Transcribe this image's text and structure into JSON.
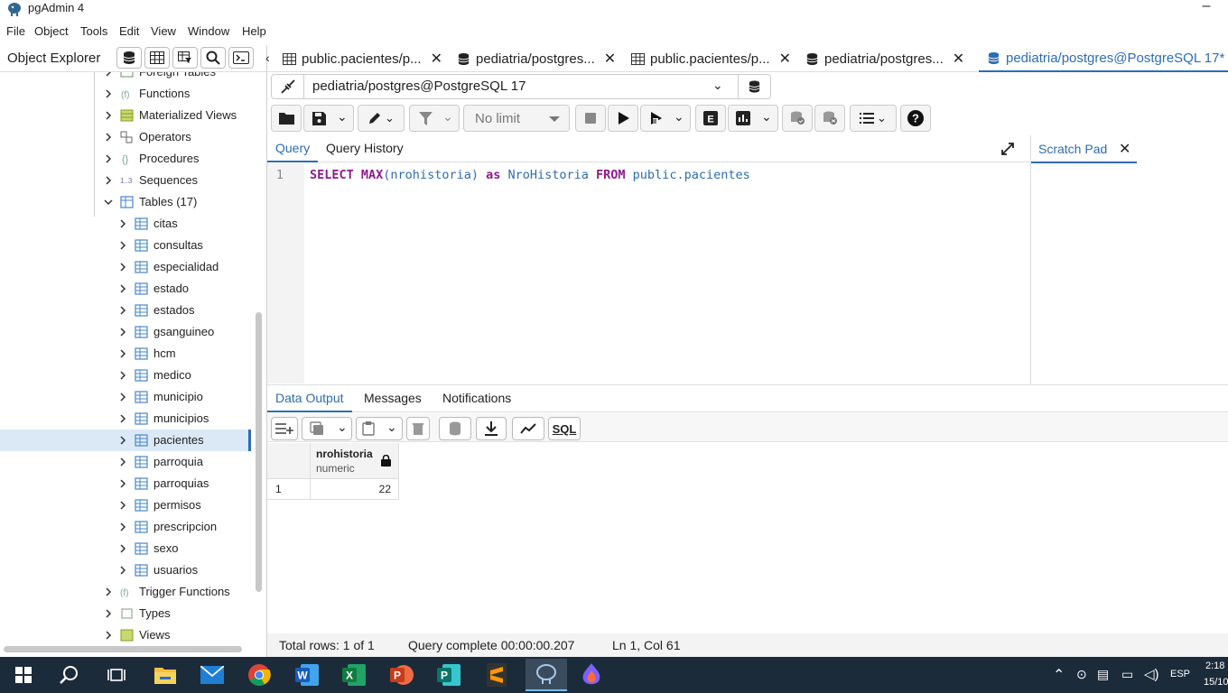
{
  "app": {
    "title": "pgAdmin 4"
  },
  "menu": [
    "File",
    "Object",
    "Tools",
    "Edit",
    "View",
    "Window",
    "Help"
  ],
  "explorer": {
    "title": "Object Explorer",
    "tree": [
      {
        "label": "Foreign Tables",
        "level": 1,
        "expanded": false,
        "icon": "foreign-table-icon"
      },
      {
        "label": "Functions",
        "level": 1,
        "expanded": false,
        "icon": "function-icon"
      },
      {
        "label": "Materialized Views",
        "level": 1,
        "expanded": false,
        "icon": "mview-icon"
      },
      {
        "label": "Operators",
        "level": 1,
        "expanded": false,
        "icon": "operator-icon"
      },
      {
        "label": "Procedures",
        "level": 1,
        "expanded": false,
        "icon": "procedure-icon"
      },
      {
        "label": "Sequences",
        "level": 1,
        "expanded": false,
        "icon": "sequence-icon"
      },
      {
        "label": "Tables (17)",
        "level": 1,
        "expanded": true,
        "icon": "tables-icon"
      },
      {
        "label": "citas",
        "level": 2,
        "expanded": false,
        "icon": "table-icon"
      },
      {
        "label": "consultas",
        "level": 2,
        "expanded": false,
        "icon": "table-icon"
      },
      {
        "label": "especialidad",
        "level": 2,
        "expanded": false,
        "icon": "table-icon"
      },
      {
        "label": "estado",
        "level": 2,
        "expanded": false,
        "icon": "table-icon"
      },
      {
        "label": "estados",
        "level": 2,
        "expanded": false,
        "icon": "table-icon"
      },
      {
        "label": "gsanguineo",
        "level": 2,
        "expanded": false,
        "icon": "table-icon"
      },
      {
        "label": "hcm",
        "level": 2,
        "expanded": false,
        "icon": "table-icon"
      },
      {
        "label": "medico",
        "level": 2,
        "expanded": false,
        "icon": "table-icon"
      },
      {
        "label": "municipio",
        "level": 2,
        "expanded": false,
        "icon": "table-icon"
      },
      {
        "label": "municipios",
        "level": 2,
        "expanded": false,
        "icon": "table-icon"
      },
      {
        "label": "pacientes",
        "level": 2,
        "expanded": false,
        "icon": "table-icon",
        "selected": true
      },
      {
        "label": "parroquia",
        "level": 2,
        "expanded": false,
        "icon": "table-icon"
      },
      {
        "label": "parroquias",
        "level": 2,
        "expanded": false,
        "icon": "table-icon"
      },
      {
        "label": "permisos",
        "level": 2,
        "expanded": false,
        "icon": "table-icon"
      },
      {
        "label": "prescripcion",
        "level": 2,
        "expanded": false,
        "icon": "table-icon"
      },
      {
        "label": "sexo",
        "level": 2,
        "expanded": false,
        "icon": "table-icon"
      },
      {
        "label": "usuarios",
        "level": 2,
        "expanded": false,
        "icon": "table-icon"
      },
      {
        "label": "Trigger Functions",
        "level": 1,
        "expanded": false,
        "icon": "trigger-function-icon"
      },
      {
        "label": "Types",
        "level": 1,
        "expanded": false,
        "icon": "type-icon"
      },
      {
        "label": "Views",
        "level": 1,
        "expanded": false,
        "icon": "view-icon"
      }
    ]
  },
  "tabs": [
    {
      "label": "public.pacientes/p...",
      "icon": "table-icon",
      "active": false
    },
    {
      "label": "pediatria/postgres...",
      "icon": "database-icon",
      "active": false
    },
    {
      "label": "public.pacientes/p...",
      "icon": "table-icon",
      "active": false
    },
    {
      "label": "pediatria/postgres...",
      "icon": "database-icon",
      "active": false
    },
    {
      "label": "pediatria/postgres@PostgreSQL 17*",
      "icon": "database-icon",
      "active": true
    }
  ],
  "connection": {
    "value": "pediatria/postgres@PostgreSQL 17"
  },
  "toolbar": {
    "limit": "No limit"
  },
  "query_tabs": {
    "query": "Query",
    "history": "Query History"
  },
  "editor": {
    "line_number": "1",
    "tokens": [
      {
        "text": "SELECT",
        "kind": "kw"
      },
      {
        "text": " MAX",
        "kind": "kw"
      },
      {
        "text": "(nrohistoria)",
        "kind": "id"
      },
      {
        "text": " as",
        "kind": "kw"
      },
      {
        "text": " NroHistoria",
        "kind": "id"
      },
      {
        "text": " FROM",
        "kind": "kw"
      },
      {
        "text": " public.pacientes",
        "kind": "id"
      }
    ]
  },
  "scratch_pad": {
    "title": "Scratch Pad"
  },
  "output_tabs": {
    "data": "Data Output",
    "messages": "Messages",
    "notifications": "Notifications"
  },
  "output_toolbar": {
    "sql": "SQL"
  },
  "grid": {
    "column": {
      "name": "nrohistoria",
      "type": "numeric"
    },
    "rows": [
      {
        "index": "1",
        "value": "22"
      }
    ]
  },
  "status": {
    "rows": "Total rows: 1 of 1",
    "query": "Query complete 00:00:00.207",
    "position": "Ln 1, Col 61"
  },
  "taskbar": {
    "time": "2:18",
    "date": "15/10",
    "lang": "ESP"
  },
  "colors": {
    "accent": "#2c6db3",
    "keyword": "#8e1b8e",
    "identifier": "#2c6db3",
    "selection": "#dbe9f7",
    "taskbar": "#1c2b3a"
  }
}
